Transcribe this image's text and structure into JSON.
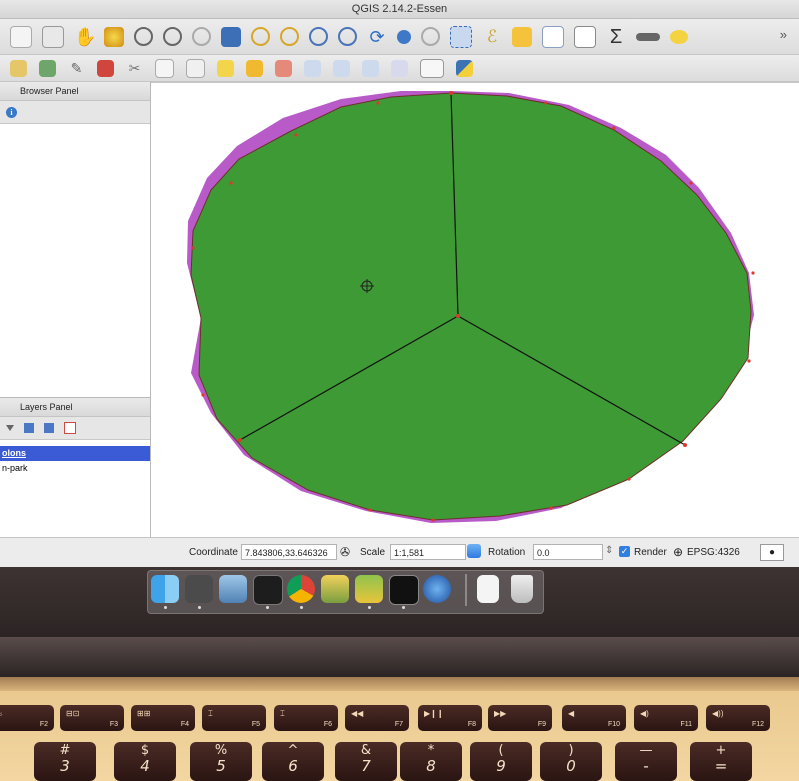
{
  "window": {
    "title": "QGIS 2.14.2-Essen"
  },
  "toolbar": {
    "overflow_label": "»"
  },
  "browser_panel": {
    "title": "Browser Panel"
  },
  "layers_panel": {
    "title": "Layers Panel",
    "layers": [
      {
        "label": "olons",
        "selected": true
      },
      {
        "label": "n-park",
        "selected": false
      }
    ]
  },
  "statusbar": {
    "coordinate_label": "Coordinate",
    "coordinate_value": "7.843806,33.646326",
    "scale_label": "Scale",
    "scale_value": "1:1,581",
    "rotation_label": "Rotation",
    "rotation_value": "0.0",
    "render_label": "Render",
    "render_checked": true,
    "crs_label": "EPSG:4326"
  },
  "map": {
    "fill_color": "#3e9a35",
    "outline_color": "#6e2f2a",
    "underlay_color": "#b85bc8"
  },
  "dock": {
    "icons": [
      "finder-icon",
      "sublime-text-icon",
      "preview-icon",
      "activity-monitor-icon",
      "chrome-icon",
      "pgadmin-icon",
      "qgis-icon",
      "terminal-icon",
      "google-earth-icon",
      "document-icon",
      "trash-icon"
    ]
  },
  "keyboard": {
    "function_keys": [
      {
        "glyph": "☼",
        "fn": "F2"
      },
      {
        "glyph": "⊟⊡",
        "fn": "F3"
      },
      {
        "glyph": "⊞⊞",
        "fn": "F4"
      },
      {
        "glyph": "⌶",
        "fn": "F5"
      },
      {
        "glyph": "⌶",
        "fn": "F6"
      },
      {
        "glyph": "◀◀",
        "fn": "F7"
      },
      {
        "glyph": "▶❙❙",
        "fn": "F8"
      },
      {
        "glyph": "▶▶",
        "fn": "F9"
      },
      {
        "glyph": "◀",
        "fn": "F10"
      },
      {
        "glyph": "◀)",
        "fn": "F11"
      },
      {
        "glyph": "◀))",
        "fn": "F12"
      }
    ],
    "number_keys": [
      {
        "sym": "#",
        "dig": "3"
      },
      {
        "sym": "$",
        "dig": "4"
      },
      {
        "sym": "%",
        "dig": "5"
      },
      {
        "sym": "^",
        "dig": "6"
      },
      {
        "sym": "&",
        "dig": "7"
      },
      {
        "sym": "*",
        "dig": "8"
      },
      {
        "sym": "(",
        "dig": "9"
      },
      {
        "sym": ")",
        "dig": "0"
      },
      {
        "sym": "—",
        "dig": "-"
      },
      {
        "sym": "+",
        "dig": "="
      }
    ]
  }
}
